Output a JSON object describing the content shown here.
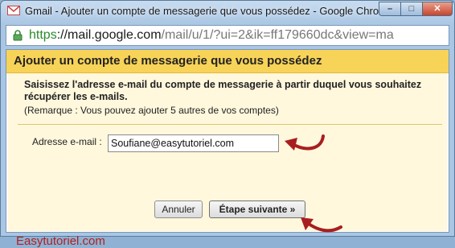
{
  "window": {
    "title": "Gmail - Ajouter un compte de messagerie que vous possédez - Google Chrome",
    "minimize_glyph": "–",
    "maximize_glyph": "□",
    "close_glyph": "✕"
  },
  "addressbar": {
    "scheme": "https",
    "host": "://mail.google.com",
    "path": "/mail/u/1/?ui=2&ik=ff179660dc&view=ma"
  },
  "dialog": {
    "title": "Ajouter un compte de messagerie que vous possédez",
    "instruction": "Saisissez l'adresse e-mail du compte de messagerie à partir duquel vous souhaitez récupérer les e-mails.",
    "remark": "(Remarque : Vous pouvez ajouter 5 autres de vos comptes)",
    "email_label": "Adresse e-mail :",
    "email_value": "Soufiane@easytutoriel.com",
    "cancel_label": "Annuler",
    "next_label": "Étape suivante »"
  },
  "watermark": {
    "brand": "Easytutoriel.com"
  },
  "colors": {
    "header_yellow": "#f7d358",
    "body_cream": "#fff8dd",
    "annotation_red": "#b02020"
  },
  "icons": {
    "app": "gmail-icon",
    "lock": "lock-icon",
    "arrows": "annotation-arrow-icon"
  }
}
